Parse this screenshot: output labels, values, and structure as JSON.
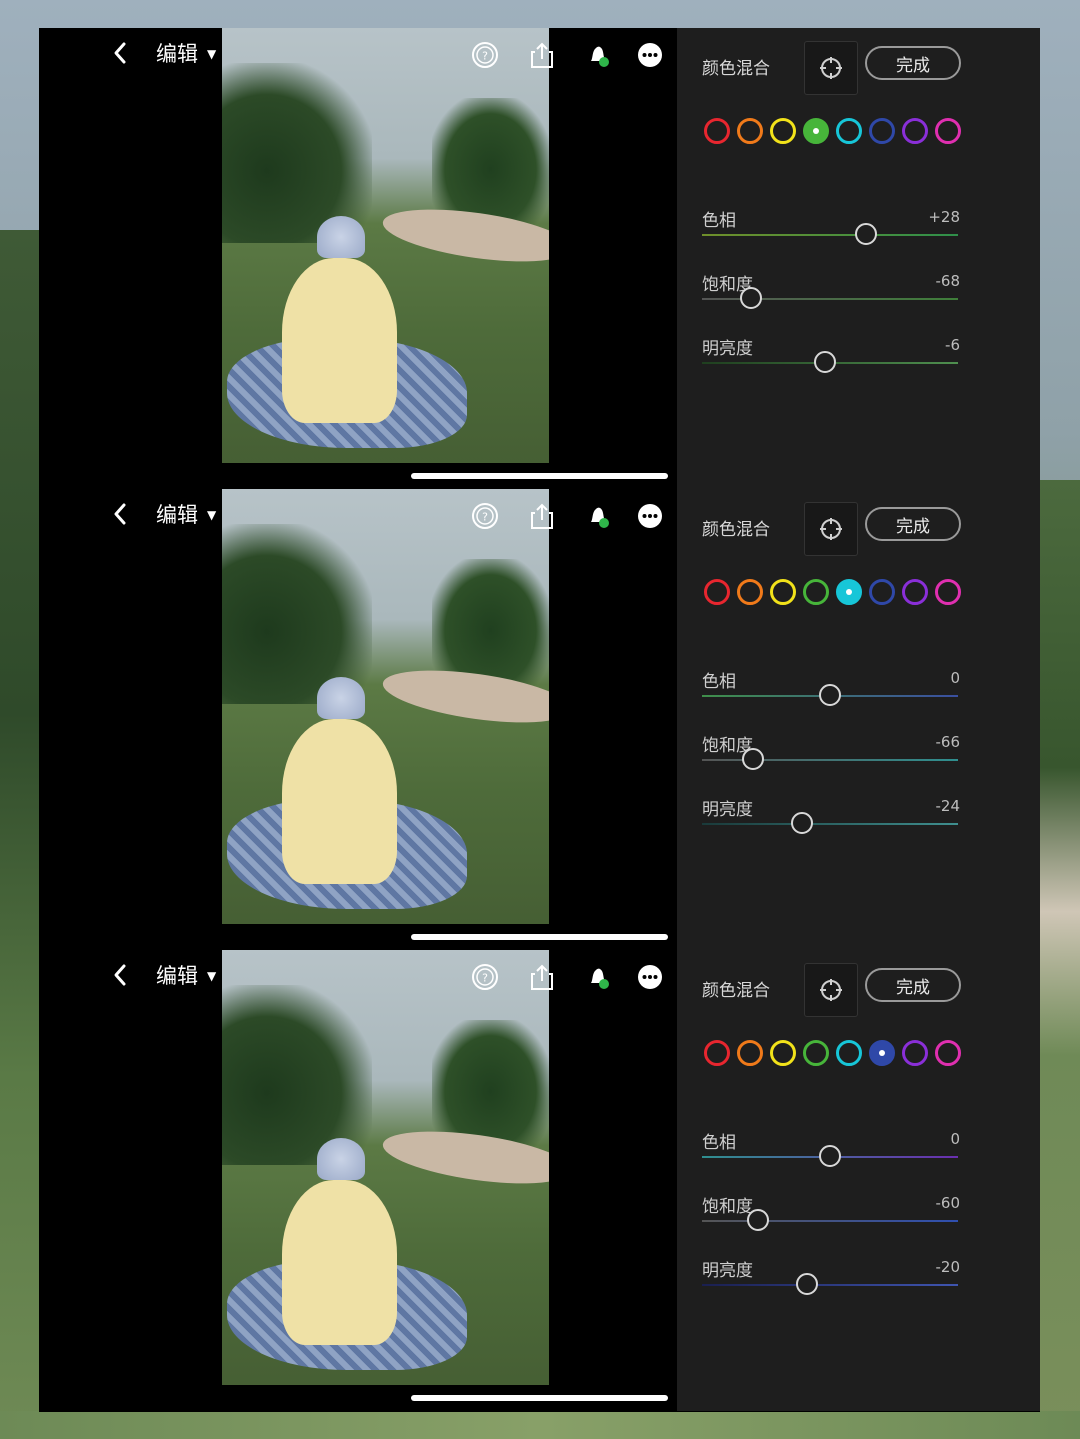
{
  "panels": [
    {
      "nav": {
        "edit_label": "编辑"
      },
      "side": {
        "title": "颜色混合",
        "done_label": "完成",
        "selected_swatch": 3,
        "sliders": [
          {
            "label": "色相",
            "value": "+28",
            "level": 0.64,
            "track": [
              "#6f8f2a",
              "#2f8f4a"
            ]
          },
          {
            "label": "饱和度",
            "value": "-68",
            "level": 0.19,
            "track": [
              "#555555",
              "#3f7f3a"
            ]
          },
          {
            "label": "明亮度",
            "value": "-6",
            "level": 0.48,
            "track": [
              "#1f3f1f",
              "#4f8f4f"
            ]
          }
        ]
      }
    },
    {
      "nav": {
        "edit_label": "编辑"
      },
      "side": {
        "title": "颜色混合",
        "done_label": "完成",
        "selected_swatch": 4,
        "sliders": [
          {
            "label": "色相",
            "value": "0",
            "level": 0.5,
            "track": [
              "#3f8f4a",
              "#3a4fa0"
            ]
          },
          {
            "label": "饱和度",
            "value": "-66",
            "level": 0.2,
            "track": [
              "#555555",
              "#2f8f8f"
            ]
          },
          {
            "label": "明亮度",
            "value": "-24",
            "level": 0.39,
            "track": [
              "#1a3a3a",
              "#3f8f8f"
            ]
          }
        ]
      }
    },
    {
      "nav": {
        "edit_label": "编辑"
      },
      "side": {
        "title": "颜色混合",
        "done_label": "完成",
        "selected_swatch": 5,
        "sliders": [
          {
            "label": "色相",
            "value": "0",
            "level": 0.5,
            "track": [
              "#2f8f8f",
              "#6a2fb0"
            ]
          },
          {
            "label": "饱和度",
            "value": "-60",
            "level": 0.22,
            "track": [
              "#555555",
              "#2f4fb0"
            ]
          },
          {
            "label": "明亮度",
            "value": "-20",
            "level": 0.41,
            "track": [
              "#1a1f4f",
              "#3f55b0"
            ]
          }
        ]
      }
    }
  ],
  "swatch_colors": [
    "#e8262f",
    "#f07a1a",
    "#f2e21a",
    "#47b53a",
    "#17c6d8",
    "#2f48a8",
    "#8a2fd8",
    "#e02fb0"
  ],
  "icons": [
    "back-icon",
    "help-icon",
    "share-icon",
    "bell-icon",
    "more-icon",
    "target-icon"
  ]
}
